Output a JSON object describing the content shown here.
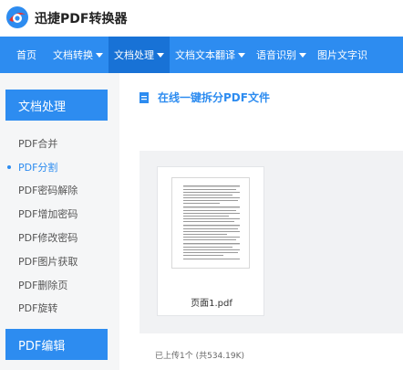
{
  "header": {
    "app_title": "迅捷PDF转换器",
    "logo_icon": "app-logo-icon"
  },
  "nav": {
    "items": [
      {
        "label": "首页",
        "has_caret": false,
        "active": false
      },
      {
        "label": "文档转换",
        "has_caret": true,
        "active": false
      },
      {
        "label": "文档处理",
        "has_caret": true,
        "active": true
      },
      {
        "label": "文档文本翻译",
        "has_caret": true,
        "active": false
      },
      {
        "label": "语音识别",
        "has_caret": true,
        "active": false
      },
      {
        "label": "图片文字识",
        "has_caret": false,
        "active": false
      }
    ]
  },
  "sidebar": {
    "header": "文档处理",
    "items": [
      {
        "label": "PDF合并",
        "active": false
      },
      {
        "label": "PDF分割",
        "active": true
      },
      {
        "label": "PDF密码解除",
        "active": false
      },
      {
        "label": "PDF增加密码",
        "active": false
      },
      {
        "label": "PDF修改密码",
        "active": false
      },
      {
        "label": "PDF图片获取",
        "active": false
      },
      {
        "label": "PDF删除页",
        "active": false
      },
      {
        "label": "PDF旋转",
        "active": false
      }
    ],
    "footer": "PDF编辑"
  },
  "main": {
    "title": "在线一键拆分PDF文件",
    "title_icon": "document-icon",
    "file": {
      "name": "页面1.pdf"
    },
    "status": "已上传1个 (共534.19K)"
  },
  "colors": {
    "accent": "#2d8cf0",
    "nav_active": "#1872d6",
    "sidebar_bg": "#f5f6f7",
    "upload_bg": "#f1f2f4"
  }
}
